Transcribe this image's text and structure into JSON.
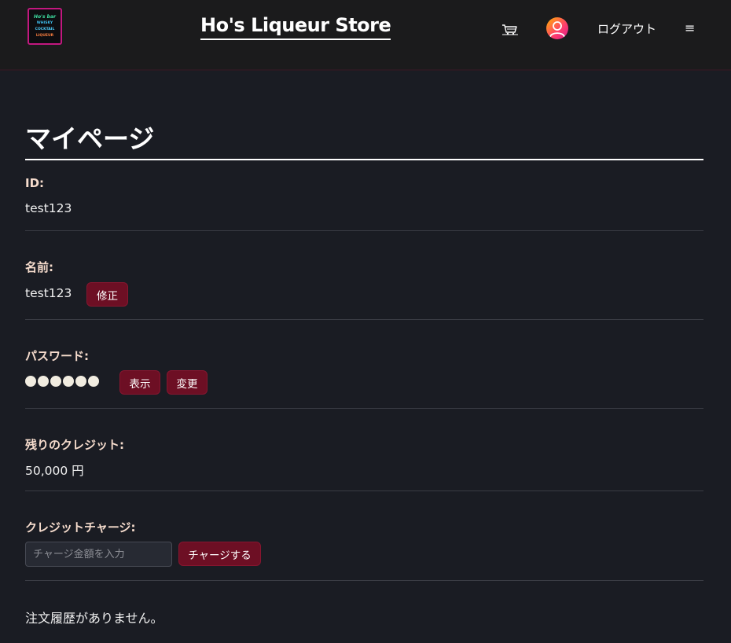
{
  "header": {
    "logo": {
      "line1": "Ho's bar",
      "line2": "WHISKY",
      "line3": "COCKTAIL",
      "line4": "LIQUEUR"
    },
    "store_title": "Ho's Liqueur Store",
    "cart_icon": "cart-icon",
    "avatar_icon": "user-avatar-icon",
    "logout_label": "ログアウト",
    "menu_icon": "≡"
  },
  "page": {
    "title": "マイページ"
  },
  "profile": {
    "id_label": "ID:",
    "id_value": "test123",
    "name_label": "名前:",
    "name_value": "test123",
    "name_edit_button": "修正",
    "password_label": "パスワード:",
    "password_mask_count": 6,
    "password_show_button": "表示",
    "password_change_button": "変更",
    "credit_label": "残りのクレジット:",
    "credit_value": "50,000 円",
    "charge_label": "クレジットチャージ:",
    "charge_placeholder": "チャージ金額を入力",
    "charge_button": "チャージする"
  },
  "orders": {
    "empty_message": "注文履歴がありません。"
  },
  "colors": {
    "background": "#1a1c23",
    "header_background": "#1b1b1c",
    "button_background": "#6d0f24",
    "label_color": "#f6dccd"
  }
}
